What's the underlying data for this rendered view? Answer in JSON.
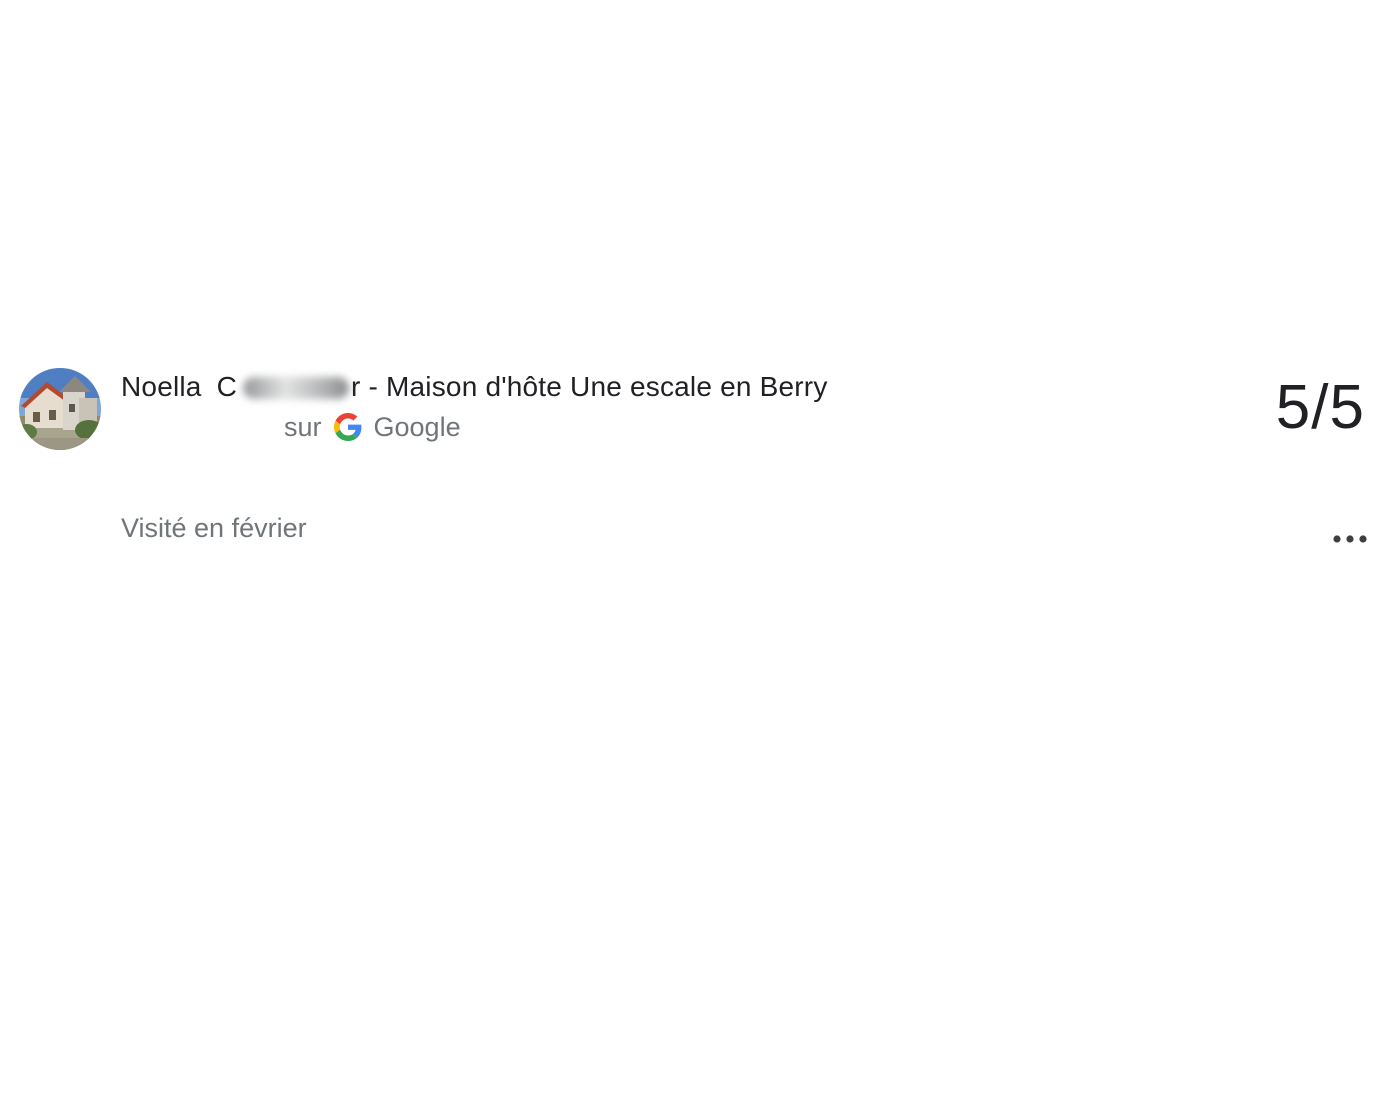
{
  "review": {
    "author_first": "Noella",
    "author_redacted_visible": "C",
    "author_tail": "r - Maison d'hôte Une escale en Berry",
    "source_prefix": "sur",
    "source_name": "Google",
    "score": "5/5",
    "visited": "Visité en février",
    "more_icon": "more-horiz-icon",
    "google_icon": "google-g-icon"
  },
  "colors": {
    "primary_text": "#202124",
    "secondary_text": "#70757a",
    "google_blue": "#4285F4",
    "google_red": "#EA4335",
    "google_yellow": "#FBBC05",
    "google_green": "#34A853"
  }
}
